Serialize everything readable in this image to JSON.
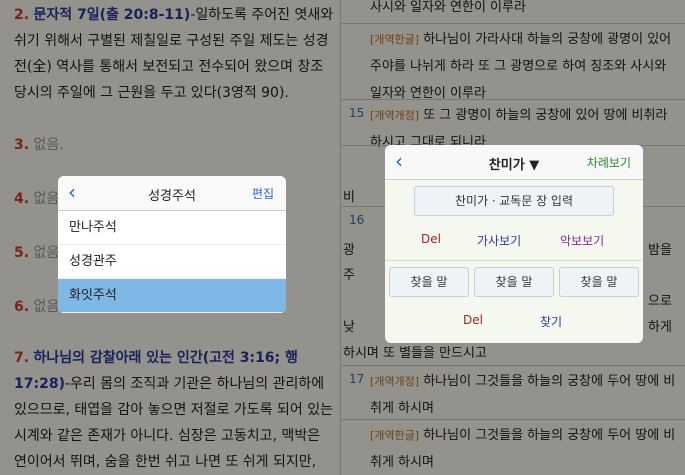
{
  "left_pane": {
    "note2_num": "2.",
    "note2_head": "문자적 7일(출 20:8-11)",
    "note2_text": "-일하도록 주어진 엿새와 쉬기 위해서 구별된 제칠일로 구성된 주일 제도는 성경 전(全) 역사를 통해서 보전되고 전수되어 왔으며 창조 당시의 주일에 그 근원을 두고 있다(3영적 90).",
    "note3_num": "3.",
    "note3_text": "없음.",
    "note4_num": "4.",
    "note4_text": "없음.",
    "note5_num": "5.",
    "note5_text": "없음.",
    "note6_num": "6.",
    "note6_text": "없음.",
    "note7_num": "7.",
    "note7_head": "하나님의 감찰아래 있는 인간(고전 3:16; 행 17:28)",
    "note7_text": "-우리 몸의 조직과 기관은 하나님의 관리하에 있으므로, 태엽을 감아 놓으면 저절로 가도록 되어 있는 시계와 같은 존재가 아니다. 심장은 고동치고, 맥박은 연이어서 뛰며, 숨을 한번 쉬고 나면 또 쉬게 되지만,"
  },
  "right_pane": {
    "rows": [
      {
        "num": "",
        "tag": "",
        "text": "사시와 일자와 연한이 이루라"
      },
      {
        "num": "",
        "tag": "[개역한글]",
        "text": "하나님이 가라사대 하늘의 궁창에 광명이 있어 주야를 나뉘게 하라 또 그 광명으로 하여 징조와 사시와 일자와 연한이 이루라"
      },
      {
        "num": "15",
        "tag": "[개역개정]",
        "text": "또 그 광명이 하늘의 궁창에 있어 땅에 비취라 하시고 그대로 되니라"
      },
      {
        "num": "17",
        "tag": "[개역개정]",
        "text": "하나님이 그것들을 하늘의 궁창에 두어 땅에 비취게 하시며"
      },
      {
        "num": "",
        "tag": "[개역한글]",
        "text": "하나님이 그것들을 하늘의 궁창에 두어 땅에 비취게 하시며"
      }
    ],
    "partial_bi": "비",
    "partial_16": "16",
    "partial_gwang": "광",
    "partial_ju": "주",
    "partial_bam": "밤을",
    "partial_euro": "으로",
    "partial_nat": "낮",
    "partial_hage": "하게",
    "partial_byeol": "하시며 또 별들을 만드시고"
  },
  "popup_commentary": {
    "back_icon": "‹",
    "title": "성경주석",
    "edit_label": "편집",
    "items": [
      "만나주석",
      "성경관주",
      "화잇주석"
    ],
    "selected_index": 2
  },
  "popup_hymn": {
    "back_icon": "‹",
    "title": "찬미가 ▼",
    "toc_label": "차례보기",
    "search_placeholder": "찬미가ㆍ교독문 장 입력",
    "del_label": "Del",
    "lyrics_label": "가사보기",
    "score_label": "악보보기",
    "find_labels": [
      "찾을 말",
      "찾을 말",
      "찾을 말"
    ],
    "del2_label": "Del",
    "find_label": "찾기"
  },
  "colors": {
    "accent_blue": "#2266cc",
    "note_red": "#d23a2a",
    "heading_blue": "#2a3a9c",
    "selected": "#7fb7e6"
  }
}
